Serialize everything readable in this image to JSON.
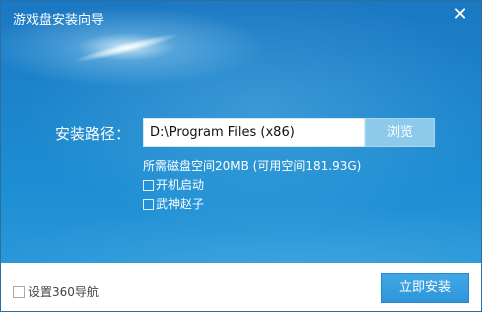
{
  "window": {
    "title": "游戏盘安装向导",
    "close_glyph": "✕"
  },
  "form": {
    "path_label": "安装路径：",
    "path_value": "D:\\Program Files (x86)",
    "browse_label": "浏览",
    "space_info": "所需磁盘空间20MB (可用空间181.93G)",
    "options": [
      {
        "label": "开机启动",
        "checked": false
      },
      {
        "label": "武神赵子",
        "checked": false
      }
    ]
  },
  "footer": {
    "nav_option_label": "设置360导航",
    "nav_option_checked": false,
    "install_label": "立即安装"
  },
  "colors": {
    "accent": "#2f95da",
    "hero_blue": "#1c86cd"
  },
  "icons": {
    "close": "close-icon",
    "checkbox": "checkbox-icon"
  }
}
